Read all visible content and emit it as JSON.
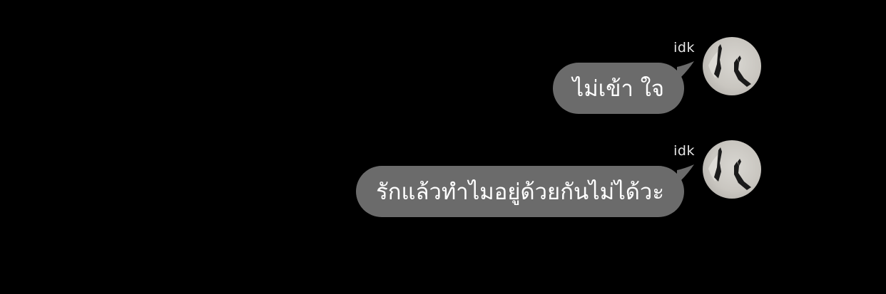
{
  "messages": [
    {
      "sender": "idk",
      "text": "ไม่เข้า ใจ"
    },
    {
      "sender": "idk",
      "text": "รักแล้วทำไมอยู่ด้วยกันไม่ได้วะ"
    }
  ],
  "colors": {
    "background": "#000000",
    "bubble": "#6b6b6b",
    "text": "#ffffff",
    "sender_name": "#e6e6e6"
  }
}
